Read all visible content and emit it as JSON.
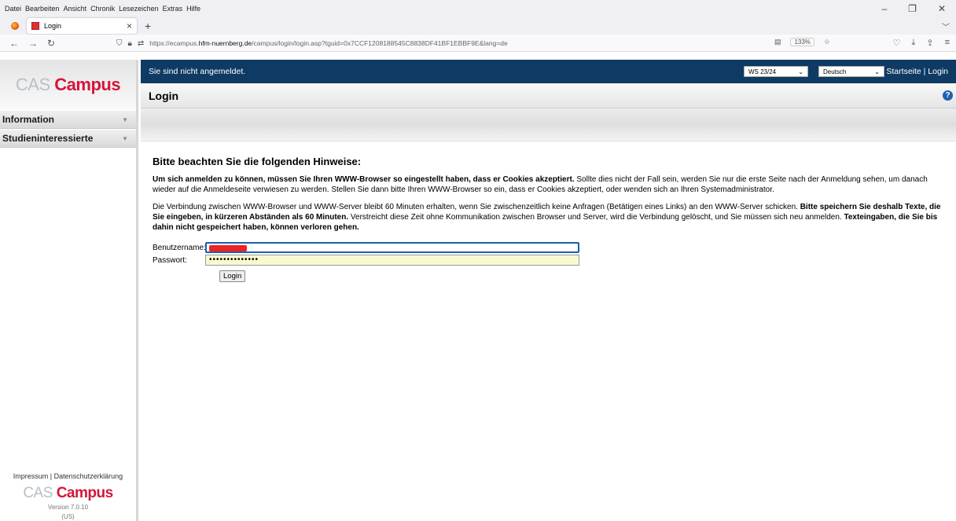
{
  "browser": {
    "menu": [
      "Datei",
      "Bearbeiten",
      "Ansicht",
      "Chronik",
      "Lesezeichen",
      "Extras",
      "Hilfe"
    ],
    "tab_title": "Login",
    "url_prefix": "https://ecampus.",
    "url_host": "hfm-nuernberg.de",
    "url_path": "/campus/login/login.asp?tguid=0x7CCF1208188545C8838DF41BF1EBBF9E&lang=de",
    "zoom": "133%"
  },
  "sidebar": {
    "logo_cas": "CAS",
    "logo_campus": "Campus",
    "items": [
      {
        "label": "Information"
      },
      {
        "label": "Studieninteressierte"
      }
    ],
    "footer_links": "Impressum | Datenschutzerklärung",
    "version": "Version 7.0.10",
    "version_region": "(US)"
  },
  "topbar": {
    "status": "Sie sind nicht angemeldet.",
    "term": "WS 23/24",
    "language": "Deutsch",
    "links": "Startseite | Login"
  },
  "page": {
    "title": "Login",
    "heading": "Bitte beachten Sie die folgenden Hinweise:",
    "p1_bold": "Um sich anmelden zu können, müssen Sie Ihren WWW-Browser so eingestellt haben, dass er Cookies akzeptiert.",
    "p1_rest": " Sollte dies nicht der Fall sein, werden Sie nur die erste Seite nach der Anmeldung sehen, um danach wieder auf die Anmeldeseite verwiesen zu werden. Stellen Sie dann bitte Ihren WWW-Browser so ein, dass er Cookies akzeptiert, oder wenden sich an Ihren Systemadministrator.",
    "p2_a": "Die Verbindung zwischen WWW-Browser und WWW-Server bleibt 60 Minuten erhalten, wenn Sie zwischenzeitlich keine Anfragen (Betätigen eines Links) an den WWW-Server schicken. ",
    "p2_b": "Bitte speichern Sie deshalb Texte, die Sie eingeben, in kürzeren Abständen als 60 Minuten.",
    "p2_c": " Verstreicht diese Zeit ohne Kommunikation zwischen Browser und Server, wird die Verbindung gelöscht, und Sie müssen sich neu anmelden. ",
    "p2_d": "Texteingaben, die Sie bis dahin nicht gespeichert haben, können verloren gehen."
  },
  "form": {
    "username_label": "Benutzername:",
    "password_label": "Passwort:",
    "password_value": "••••••••••••••",
    "login_label": "Login"
  }
}
